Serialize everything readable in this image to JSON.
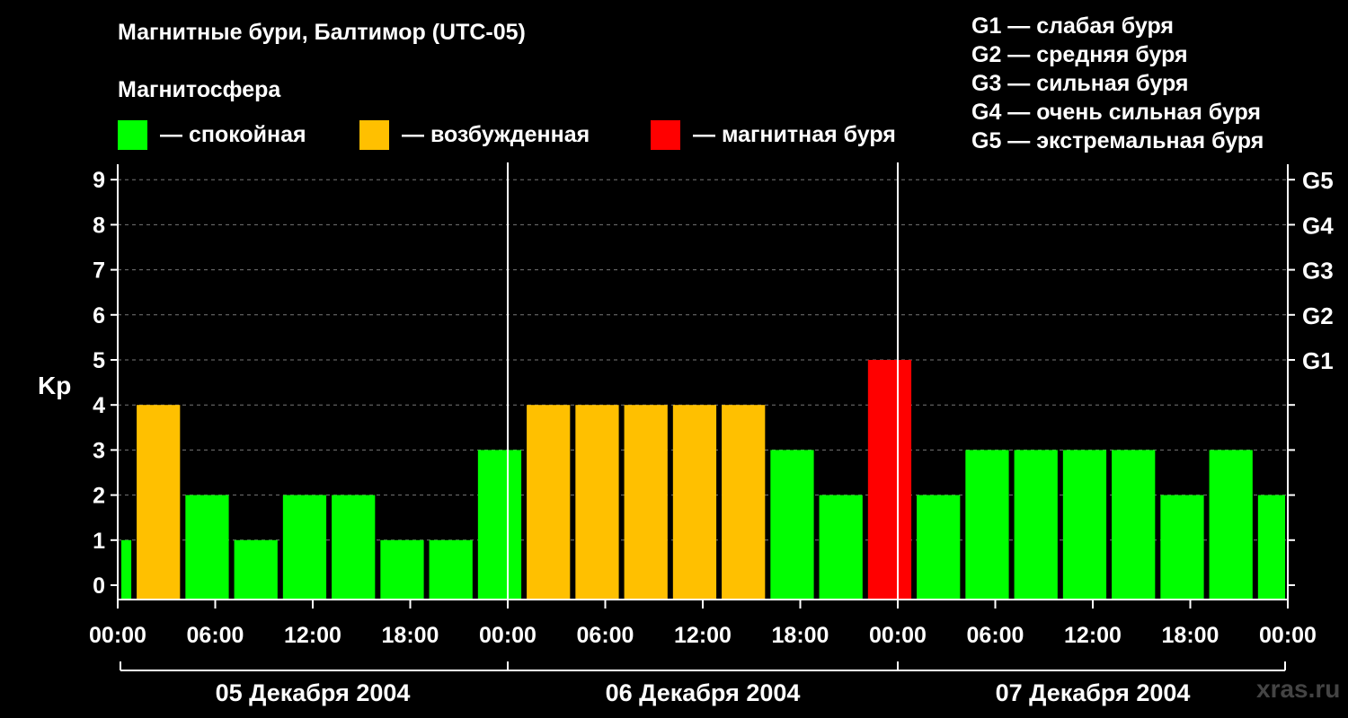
{
  "header": {
    "title": "Магнитные бури, Балтимор (UTC-05)",
    "subtitle": "Магнитосфера"
  },
  "legend": [
    {
      "color": "#00ff00",
      "label": "— спокойная"
    },
    {
      "color": "#ffc000",
      "label": "— возбужденная"
    },
    {
      "color": "#ff0000",
      "label": "— магнитная буря"
    }
  ],
  "g_legend": [
    "G1 — слабая буря",
    "G2 — средняя буря",
    "G3 — сильная буря",
    "G4 — очень сильная буря",
    "G5 — экстремальная буря"
  ],
  "watermark": "xras.ru",
  "chart_data": {
    "type": "bar",
    "ylabel": "Kp",
    "ylim": [
      0,
      9
    ],
    "yticks": [
      "0",
      "1",
      "2",
      "3",
      "4",
      "5",
      "6",
      "7",
      "8",
      "9"
    ],
    "g_ticks": [
      {
        "kp": 5,
        "label": "G1"
      },
      {
        "kp": 6,
        "label": "G2"
      },
      {
        "kp": 7,
        "label": "G3"
      },
      {
        "kp": 8,
        "label": "G4"
      },
      {
        "kp": 9,
        "label": "G5"
      }
    ],
    "xticks": [
      "00:00",
      "06:00",
      "12:00",
      "18:00",
      "00:00",
      "06:00",
      "12:00",
      "18:00",
      "00:00",
      "06:00",
      "12:00",
      "18:00",
      "00:00"
    ],
    "days": [
      "05 Декабря 2004",
      "06 Декабря 2004",
      "07 Декабря 2004"
    ],
    "colors": {
      "quiet": "#00ff00",
      "active": "#ffc000",
      "storm": "#ff0000"
    },
    "grid": "dashed horizontal",
    "bars": [
      {
        "start_hour": 0,
        "end_hour": 1,
        "kp": 1,
        "state": "quiet"
      },
      {
        "start_hour": 1,
        "end_hour": 4,
        "kp": 4,
        "state": "active"
      },
      {
        "start_hour": 4,
        "end_hour": 7,
        "kp": 2,
        "state": "quiet"
      },
      {
        "start_hour": 7,
        "end_hour": 10,
        "kp": 1,
        "state": "quiet"
      },
      {
        "start_hour": 10,
        "end_hour": 13,
        "kp": 2,
        "state": "quiet"
      },
      {
        "start_hour": 13,
        "end_hour": 16,
        "kp": 2,
        "state": "quiet"
      },
      {
        "start_hour": 16,
        "end_hour": 19,
        "kp": 1,
        "state": "quiet"
      },
      {
        "start_hour": 19,
        "end_hour": 22,
        "kp": 1,
        "state": "quiet"
      },
      {
        "start_hour": 22,
        "end_hour": 25,
        "kp": 3,
        "state": "quiet"
      },
      {
        "start_hour": 25,
        "end_hour": 28,
        "kp": 4,
        "state": "active"
      },
      {
        "start_hour": 28,
        "end_hour": 31,
        "kp": 4,
        "state": "active"
      },
      {
        "start_hour": 31,
        "end_hour": 34,
        "kp": 4,
        "state": "active"
      },
      {
        "start_hour": 34,
        "end_hour": 37,
        "kp": 4,
        "state": "active"
      },
      {
        "start_hour": 37,
        "end_hour": 40,
        "kp": 4,
        "state": "active"
      },
      {
        "start_hour": 40,
        "end_hour": 43,
        "kp": 3,
        "state": "quiet"
      },
      {
        "start_hour": 43,
        "end_hour": 46,
        "kp": 2,
        "state": "quiet"
      },
      {
        "start_hour": 46,
        "end_hour": 49,
        "kp": 5,
        "state": "storm"
      },
      {
        "start_hour": 49,
        "end_hour": 52,
        "kp": 2,
        "state": "quiet"
      },
      {
        "start_hour": 52,
        "end_hour": 55,
        "kp": 3,
        "state": "quiet"
      },
      {
        "start_hour": 55,
        "end_hour": 58,
        "kp": 3,
        "state": "quiet"
      },
      {
        "start_hour": 58,
        "end_hour": 61,
        "kp": 3,
        "state": "quiet"
      },
      {
        "start_hour": 61,
        "end_hour": 64,
        "kp": 3,
        "state": "quiet"
      },
      {
        "start_hour": 64,
        "end_hour": 67,
        "kp": 2,
        "state": "quiet"
      },
      {
        "start_hour": 67,
        "end_hour": 70,
        "kp": 3,
        "state": "quiet"
      },
      {
        "start_hour": 70,
        "end_hour": 72,
        "kp": 2,
        "state": "quiet"
      }
    ]
  }
}
